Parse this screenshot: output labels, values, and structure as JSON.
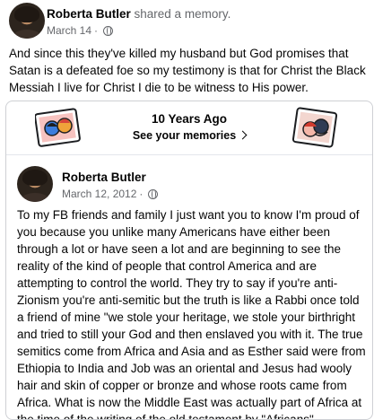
{
  "post": {
    "author": "Roberta Butler",
    "action": "shared a memory.",
    "date": "March 14",
    "date_separator": "·",
    "privacy_icon": "globe-icon",
    "text": "And since this they've killed my husband but God promises that Satan is a defeated foe so my testimony is that for Christ the Black Messiah I live for Christ I die to be witness to His power."
  },
  "memory": {
    "title": "10 Years Ago",
    "link_label": "See your memories",
    "link_icon": "chevron-right-icon"
  },
  "original_post": {
    "author": "Roberta Butler",
    "date": "March 12, 2012",
    "date_separator": "·",
    "privacy_icon": "globe-icon",
    "text": "To my FB friends and family I just want you to know I'm proud of you because you unlike many Americans have either been through a lot or have seen a lot and are beginning to see the reality of the kind of people that control America and are attempting to control the world. They try to say if you're anti-Zionism you're anti-semitic but the truth is like a Rabbi once told a friend of mine \"we stole your heritage, we stole your birthright and tried to still your God and then enslaved you with it.  The true semitics come from Africa and Asia and as Esther said were from Ethiopia to India and Job was an oriental and Jesus had wooly hair and skin of copper or bronze and whose roots came from Africa.  What is now the Middle East was actually part of Africa at the time of the writing of the old testament by \"Africans\"."
  }
}
